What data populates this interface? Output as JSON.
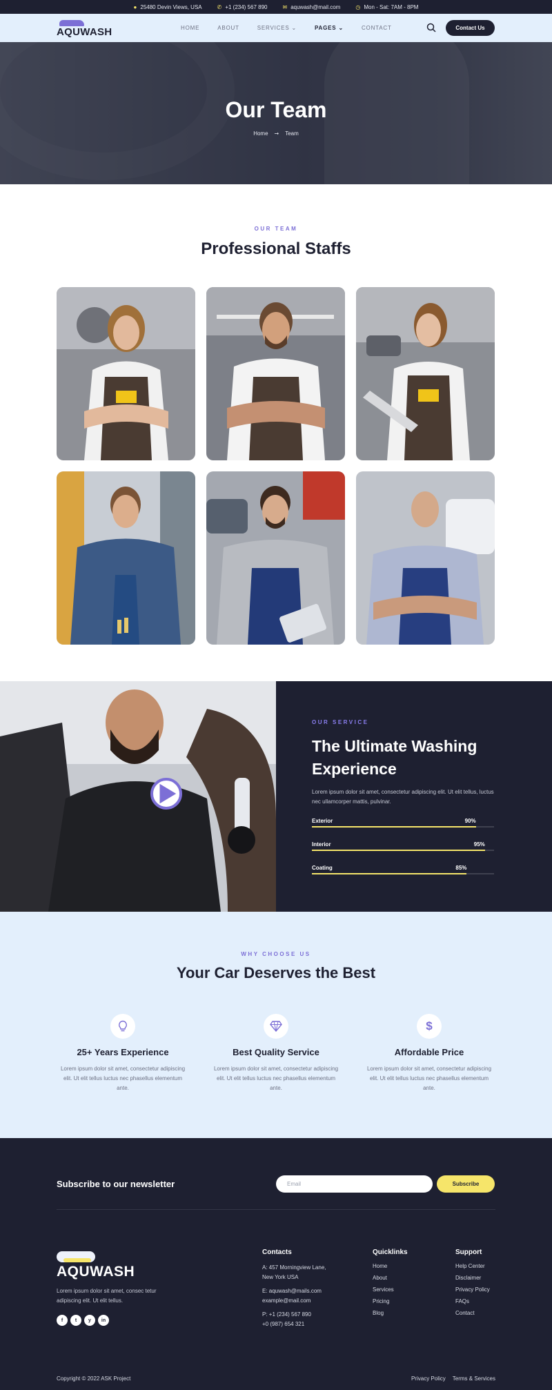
{
  "topbar": {
    "address": "25480 Devin Views, USA",
    "phone": "+1 (234) 567 890",
    "email": "aquwash@mail.com",
    "hours": "Mon - Sat: 7AM - 8PM"
  },
  "header": {
    "logo_text": "AQUWASH",
    "nav": [
      "HOME",
      "ABOUT",
      "SERVICES",
      "PAGES",
      "CONTACT"
    ],
    "contact_button": "Contact Us"
  },
  "hero": {
    "title": "Our Team",
    "breadcrumb": [
      "Home",
      "Team"
    ]
  },
  "team": {
    "eyebrow": "OUR TEAM",
    "title": "Professional Staffs"
  },
  "service": {
    "eyebrow": "OUR SERVICE",
    "title": "The Ultimate Washing Experience",
    "text": "Lorem ipsum dolor sit amet, consectetur adipiscing elit. Ut elit tellus, luctus nec ullamcorper mattis, pulvinar.",
    "bars": [
      {
        "label": "Exterior",
        "percent": 90,
        "percent_text": "90%"
      },
      {
        "label": "Interior",
        "percent": 95,
        "percent_text": "95%"
      },
      {
        "label": "Coating",
        "percent": 85,
        "percent_text": "85%"
      }
    ]
  },
  "why": {
    "eyebrow": "WHY CHOOSE US",
    "title": "Your Car Deserves the Best",
    "features": [
      {
        "icon": "lightbulb-icon",
        "title": "25+ Years Experience",
        "text": "Lorem ipsum dolor sit amet, consectetur adipiscing elit. Ut elit tellus luctus nec phasellus elementum ante."
      },
      {
        "icon": "diamond-icon",
        "title": "Best Quality Service",
        "text": "Lorem ipsum dolor sit amet, consectetur adipiscing elit. Ut elit tellus luctus nec phasellus elementum ante."
      },
      {
        "icon": "dollar-icon",
        "title": "Affordable Price",
        "text": "Lorem ipsum dolor sit amet, consectetur adipiscing elit. Ut elit tellus luctus nec phasellus elementum ante."
      }
    ]
  },
  "footer": {
    "newsletter_title": "Subscribe to our newsletter",
    "email_placeholder": "Email",
    "subscribe_button": "Subscribe",
    "logo_text": "AQUWASH",
    "description": "Lorem ipsum dolor sit amet, consec tetur adipiscing elit. Ut elit tellus.",
    "socials": [
      "f",
      "t",
      "y",
      "in"
    ],
    "contacts_title": "Contacts",
    "address_lines": [
      "A: 457 Morningview Lane,",
      "New York USA"
    ],
    "email_lines": [
      "E: aquwash@mails.com",
      "example@mail.com"
    ],
    "phone_lines": [
      "P: +1 (234) 567 890",
      "+0 (987) 654 321"
    ],
    "quicklinks_title": "Quicklinks",
    "quicklinks": [
      "Home",
      "About",
      "Services",
      "Pricing",
      "Blog"
    ],
    "support_title": "Support",
    "support": [
      "Help Center",
      "Disclaimer",
      "Privacy Policy",
      "FAQs",
      "Contact"
    ],
    "copyright": "Copyright © 2022 ASK Project",
    "legal": [
      "Privacy Policy",
      "Terms & Services"
    ]
  },
  "colors": {
    "dark": "#1e2031",
    "accent": "#7c6fd6",
    "yellow": "#f6e56a",
    "light_blue": "#e3effc"
  }
}
